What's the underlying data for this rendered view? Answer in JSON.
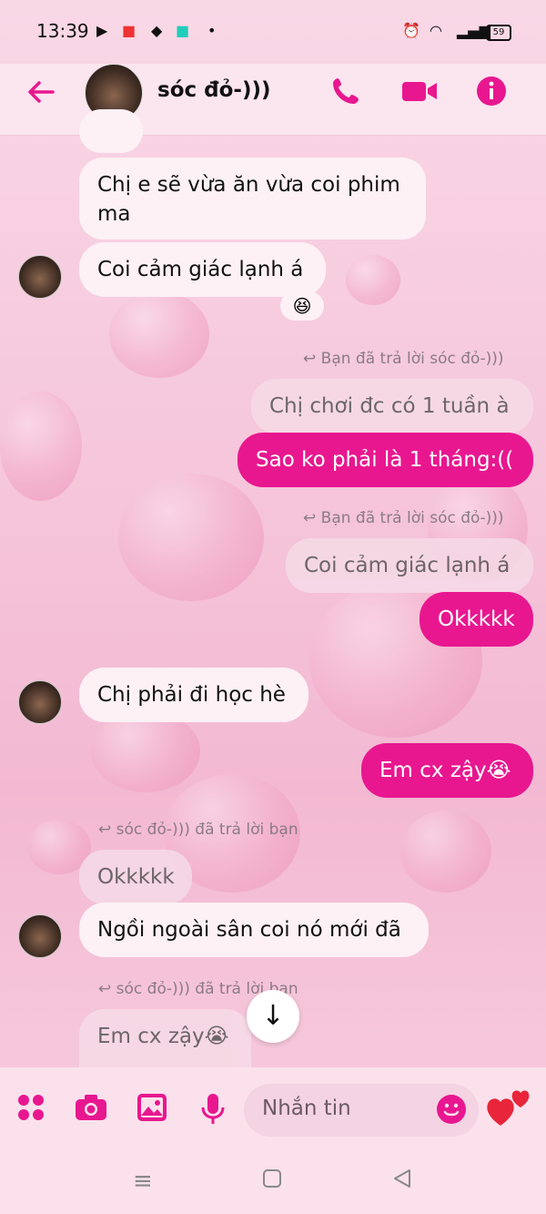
{
  "status_bar": {
    "time": "13:39",
    "battery": "59"
  },
  "header": {
    "contact_name": "sóc đỏ-)))"
  },
  "messages": [
    {
      "kind": "in",
      "text": "Chị e sẽ vừa ăn vừa coi phim"
    },
    {
      "kind": "in",
      "text": "ma"
    },
    {
      "kind": "in",
      "text": "Coi cảm giác lạnh á",
      "reaction": "😆"
    },
    {
      "kind": "reply_note",
      "text": "Bạn đã trả lời sóc đỏ-)))"
    },
    {
      "kind": "quoted",
      "text": "Chị chơi đc có 1 tuần à"
    },
    {
      "kind": "out",
      "text": "Sao ko phải là 1 tháng:(("
    },
    {
      "kind": "reply_note",
      "text": "Bạn đã trả lời sóc đỏ-)))"
    },
    {
      "kind": "quoted",
      "text": "Coi cảm giác lạnh á"
    },
    {
      "kind": "out",
      "text": "Okkkkk"
    },
    {
      "kind": "in",
      "text": "Chị phải đi học hè"
    },
    {
      "kind": "out",
      "text": "Em cx zậy😭"
    },
    {
      "kind": "reply_note",
      "text": "sóc đỏ-))) đã trả lời bạn"
    },
    {
      "kind": "quoted",
      "text": "Okkkkk"
    },
    {
      "kind": "in",
      "text": "Ngồi ngoài sân coi nó mới đã"
    },
    {
      "kind": "reply_note",
      "text": "sóc đỏ-))) đã trả lời bạn"
    },
    {
      "kind": "quoted",
      "text": "Em cx zậy😭"
    }
  ],
  "composer": {
    "placeholder": "Nhắn tin"
  },
  "colors": {
    "accent": "#e8178f",
    "incoming_bubble": "#fdf1f5",
    "background": "#f6c8dc"
  },
  "icons": [
    "back-arrow-icon",
    "phone-icon",
    "video-call-icon",
    "info-icon",
    "menu-dots-icon",
    "camera-icon",
    "image-icon",
    "microphone-icon",
    "emoji-icon",
    "heart-icon",
    "scroll-down-icon"
  ]
}
